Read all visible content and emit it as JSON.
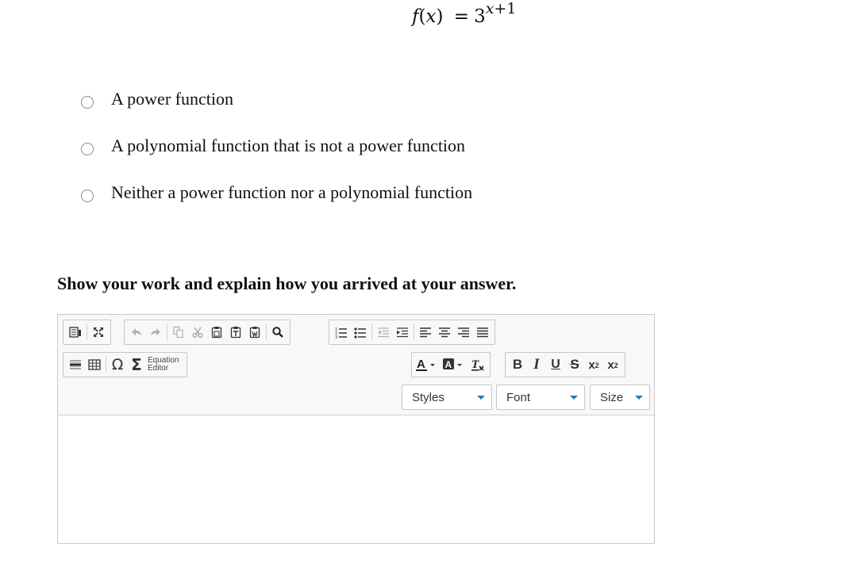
{
  "formula": {
    "lhs_fn": "f",
    "lhs_open": "(",
    "lhs_var": "x",
    "lhs_close": ")",
    "equals": "=",
    "base": "3",
    "exp_var": "x",
    "exp_rest": "+1"
  },
  "options": [
    {
      "label": "A power function"
    },
    {
      "label": "A polynomial function that is not a power function"
    },
    {
      "label": "Neither a power function nor a polynomial function"
    }
  ],
  "prompt": "Show your work and explain how you arrived at your answer.",
  "editor": {
    "equation_editor_label": [
      "Equation",
      "Editor"
    ],
    "combos": {
      "styles": "Styles",
      "font": "Font",
      "size": "Size"
    },
    "format_labels": {
      "bold": "B",
      "italic": "I",
      "underline": "U",
      "strike": "S",
      "subscript_base": "x",
      "subscript_mark": "2",
      "superscript_base": "x",
      "superscript_mark": "2"
    },
    "symbol_labels": {
      "omega": "Ω",
      "sigma": "Σ"
    },
    "icons": [
      "source-icon",
      "maximize-icon",
      "undo-icon",
      "redo-icon",
      "copy-icon",
      "cut-icon",
      "paste-icon",
      "paste-text-icon",
      "paste-word-icon",
      "find-icon",
      "numbered-list-icon",
      "bulleted-list-icon",
      "outdent-icon",
      "indent-icon",
      "align-left-icon",
      "align-center-icon",
      "align-right-icon",
      "justify-icon",
      "horizontal-rule-icon",
      "table-icon",
      "text-color-icon",
      "background-color-icon",
      "remove-format-icon"
    ]
  }
}
